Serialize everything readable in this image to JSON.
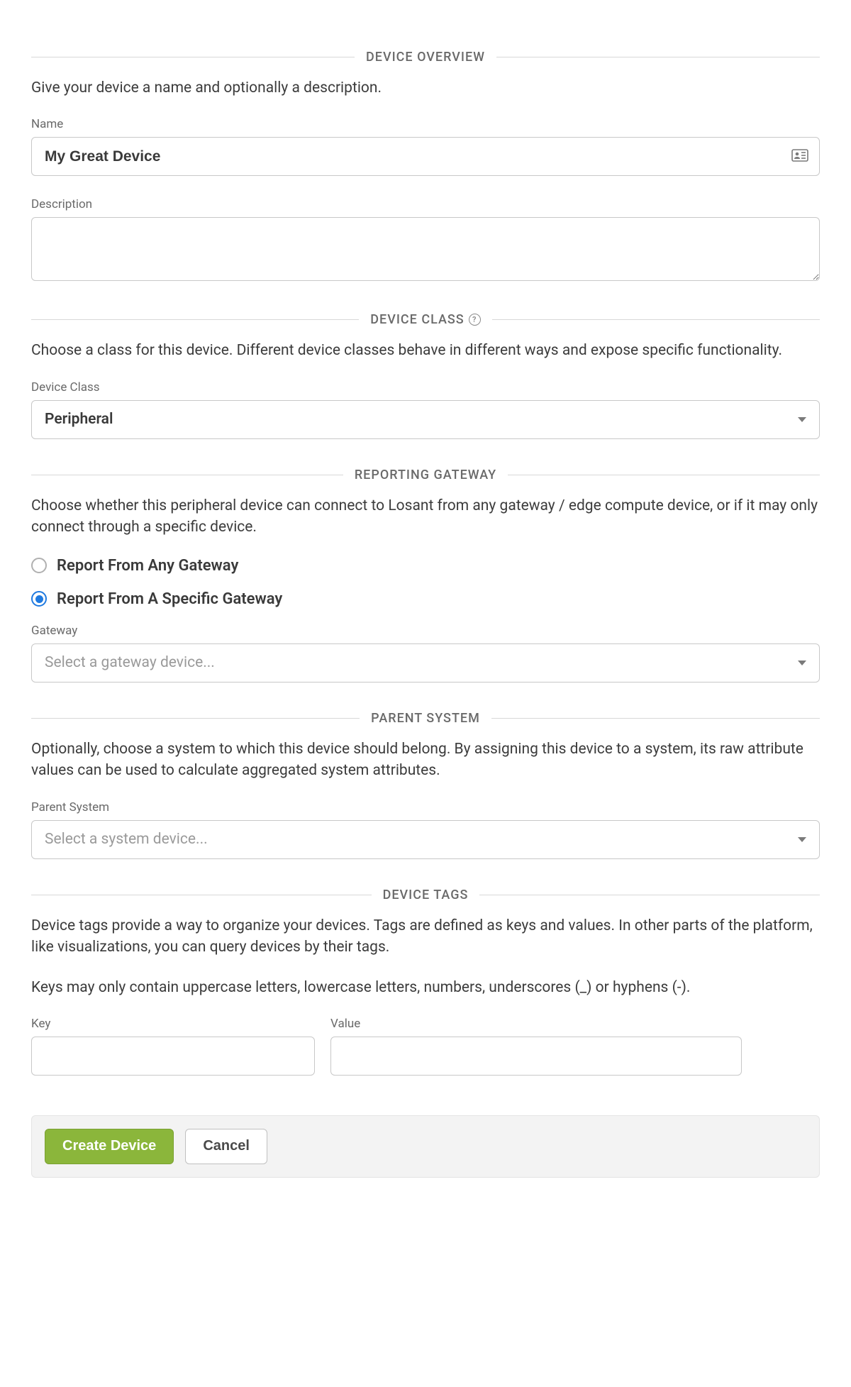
{
  "overview": {
    "title": "DEVICE OVERVIEW",
    "desc": "Give your device a name and optionally a description.",
    "name_label": "Name",
    "name_value": "My Great Device",
    "description_label": "Description",
    "description_value": ""
  },
  "device_class": {
    "title": "DEVICE CLASS",
    "desc": "Choose a class for this device. Different device classes behave in different ways and expose specific functionality.",
    "label": "Device Class",
    "value": "Peripheral"
  },
  "reporting_gateway": {
    "title": "REPORTING GATEWAY",
    "desc": "Choose whether this peripheral device can connect to Losant from any gateway / edge compute device, or if it may only connect through a specific device.",
    "option_any": "Report From Any Gateway",
    "option_specific": "Report From A Specific Gateway",
    "selected": "specific",
    "gateway_label": "Gateway",
    "gateway_placeholder": "Select a gateway device..."
  },
  "parent_system": {
    "title": "PARENT SYSTEM",
    "desc": "Optionally, choose a system to which this device should belong. By assigning this device to a system, its raw attribute values can be used to calculate aggregated system attributes.",
    "label": "Parent System",
    "placeholder": "Select a system device..."
  },
  "device_tags": {
    "title": "DEVICE TAGS",
    "desc": "Device tags provide a way to organize your devices. Tags are defined as keys and values. In other parts of the platform, like visualizations, you can query devices by their tags.",
    "note": "Keys may only contain uppercase letters, lowercase letters, numbers, underscores (_) or hyphens (-).",
    "key_label": "Key",
    "value_label": "Value"
  },
  "footer": {
    "create_label": "Create Device",
    "cancel_label": "Cancel"
  }
}
